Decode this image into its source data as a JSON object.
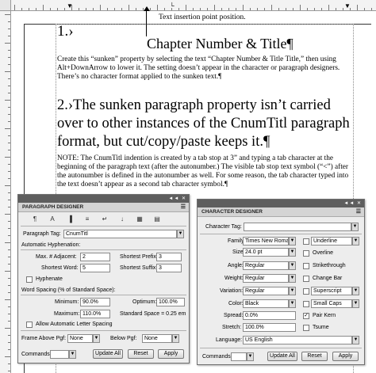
{
  "document": {
    "annotation": "Text insertion point position.",
    "heading1_number": "1.›",
    "heading1_title": "Chapter Number & Title¶",
    "body1": "Create this “sunken” property by selecting the text “Chapter Number & Title Title,” then using Alt+DownArrow to lower it. The setting doesn’t appear in the character or paragraph designers. There’s no character format applied to the sunken text.¶",
    "heading2": "2.›The sunken paragraph property isn’t carried over to other instances of the CnumTitl paragraph format, but cut/copy/paste keeps it.¶",
    "body2": "NOTE: The CnumTitl indention is created by a tab stop at 3” and typing a tab character at the beginning of the paragraph text (after the autonumber.) The visible tab stop text symbol (“<”) after the autonumber is defined in the autonumber as well. For some reason, the tab character typed into the text doesn’t appear as a second tab character symbol.¶"
  },
  "paragraph_designer": {
    "window_controls": "◄◄ ✕",
    "title": "PARAGRAPH DESIGNER",
    "menu_icon": "☰",
    "tab_icons": [
      "¶",
      "A",
      "▐",
      "≡",
      "↵",
      "↓",
      "▦",
      "▤"
    ],
    "paragraph_tag_label": "Paragraph Tag:",
    "paragraph_tag_value": "CnumTitl",
    "auto_hyphenation_label": "Automatic Hyphenation:",
    "max_adjacent_label": "Max. # Adjacent:",
    "max_adjacent_value": "2",
    "shortest_prefix_label": "Shortest Prefix:",
    "shortest_prefix_value": "3",
    "shortest_word_label": "Shortest Word:",
    "shortest_word_value": "5",
    "shortest_suffix_label": "Shortest Suffix:",
    "shortest_suffix_value": "3",
    "hyphenate_label": "Hyphenate",
    "word_spacing_label": "Word Spacing (% of Standard Space):",
    "minimum_label": "Minimum:",
    "minimum_value": "90.0%",
    "optimum_label": "Optimum:",
    "optimum_value": "100.0%",
    "maximum_label": "Maximum:",
    "maximum_value": "110.0%",
    "standard_space_text": "Standard Space = 0.25 em",
    "allow_letter_spacing_label": "Allow Automatic Letter Spacing",
    "frame_above_label": "Frame Above Pgf:",
    "frame_above_value": "None",
    "frame_below_label": "Below Pgf:",
    "frame_below_value": "None",
    "commands_label": "Commands:",
    "update_all_label": "Update All",
    "reset_label": "Reset",
    "apply_label": "Apply"
  },
  "character_designer": {
    "window_controls": "◄◄ ✕",
    "title": "CHARACTER DESIGNER",
    "menu_icon": "☰",
    "character_tag_label": "Character Tag:",
    "character_tag_value": "",
    "family_label": "Family:",
    "family_value": "Times New Romar",
    "size_label": "Size:",
    "size_value": "24.0 pt",
    "angle_label": "Angle:",
    "angle_value": "Regular",
    "weight_label": "Weight:",
    "weight_value": "Regular",
    "variation_label": "Variation:",
    "variation_value": "Regular",
    "color_label": "Color:",
    "color_value": "Black",
    "spread_label": "Spread:",
    "spread_value": "0.0%",
    "stretch_label": "Stretch:",
    "stretch_value": "100.0%",
    "language_label": "Language:",
    "language_value": "US English",
    "underline_value": "Underline",
    "overline_label": "Overline",
    "strikethrough_label": "Strikethrough",
    "change_bar_label": "Change Bar",
    "superscript_value": "Superscript",
    "small_caps_value": "Small Caps",
    "pair_kern_label": "Pair Kern",
    "tsume_label": "Tsume",
    "commands_label": "Commands:",
    "update_all_label": "Update All",
    "reset_label": "Reset",
    "apply_label": "Apply"
  },
  "colors": {
    "titlebar": "#5e5e5e",
    "panel_bg": "#ededed"
  }
}
